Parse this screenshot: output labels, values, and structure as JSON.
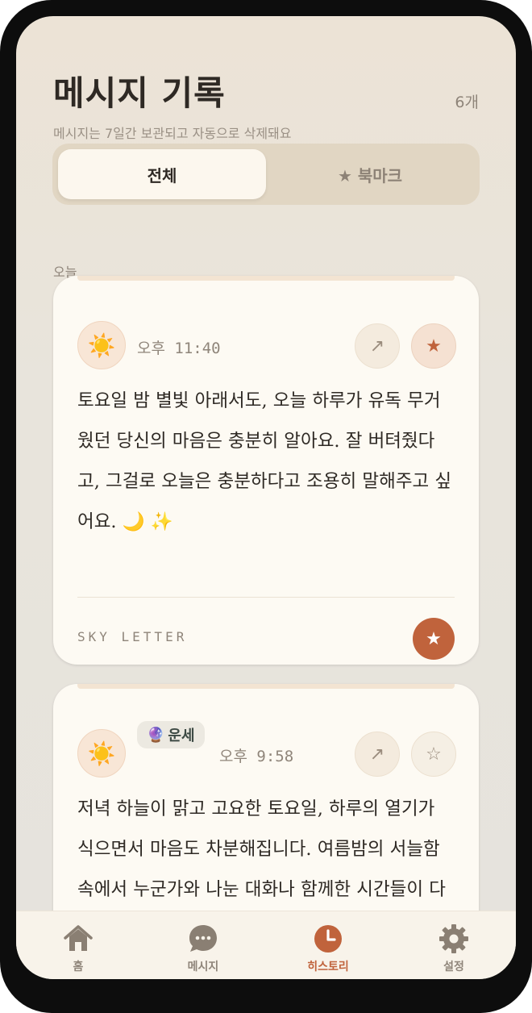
{
  "header": {
    "title": "메시지 기록",
    "count": "6개",
    "subtitle": "메시지는 7일간 보관되고 자동으로 삭제돼요"
  },
  "tabs": [
    {
      "label": "전체",
      "active": true
    },
    {
      "label": "★ 북마크",
      "active": false
    }
  ],
  "section": {
    "label": "오늘"
  },
  "messages": [
    {
      "time": "오후 11:40",
      "icon": "sun-emoji",
      "bookmarked": true,
      "text": "토요일 밤 별빛 아래서도, 오늘 하루가 유독 무거웠던 당신의 마음은 충분히 알아요. 잘 버텨줬다고, 그걸로 오늘은 충분하다고 조용히 말해주고 싶어요. 🌙 ✨",
      "footer_label": "SKY LETTER"
    },
    {
      "time": "오후 9:58",
      "icon": "sun-emoji",
      "badge": "운세",
      "bookmarked": false,
      "text": "저녁 하늘이 맑고 고요한 토요일, 하루의 열기가 식으면서 마음도 차분해집니다. 여름밤의 서늘함 속에서 누군가와 나눈 대화나 함께한 시간들이 다시 떠오르며"
    }
  ],
  "nav": [
    {
      "label": "홈",
      "icon": "home-icon",
      "active": false
    },
    {
      "label": "메시지",
      "icon": "chat-bubble-icon",
      "active": false
    },
    {
      "label": "히스토리",
      "icon": "clock-icon",
      "active": true
    },
    {
      "label": "설정",
      "icon": "gear-icon",
      "active": false
    }
  ],
  "colors": {
    "accent": "#c0633c",
    "background": "#e8e4dc",
    "card": "#fdfaf3",
    "text": "#2e2924",
    "muted": "#8f857a"
  }
}
